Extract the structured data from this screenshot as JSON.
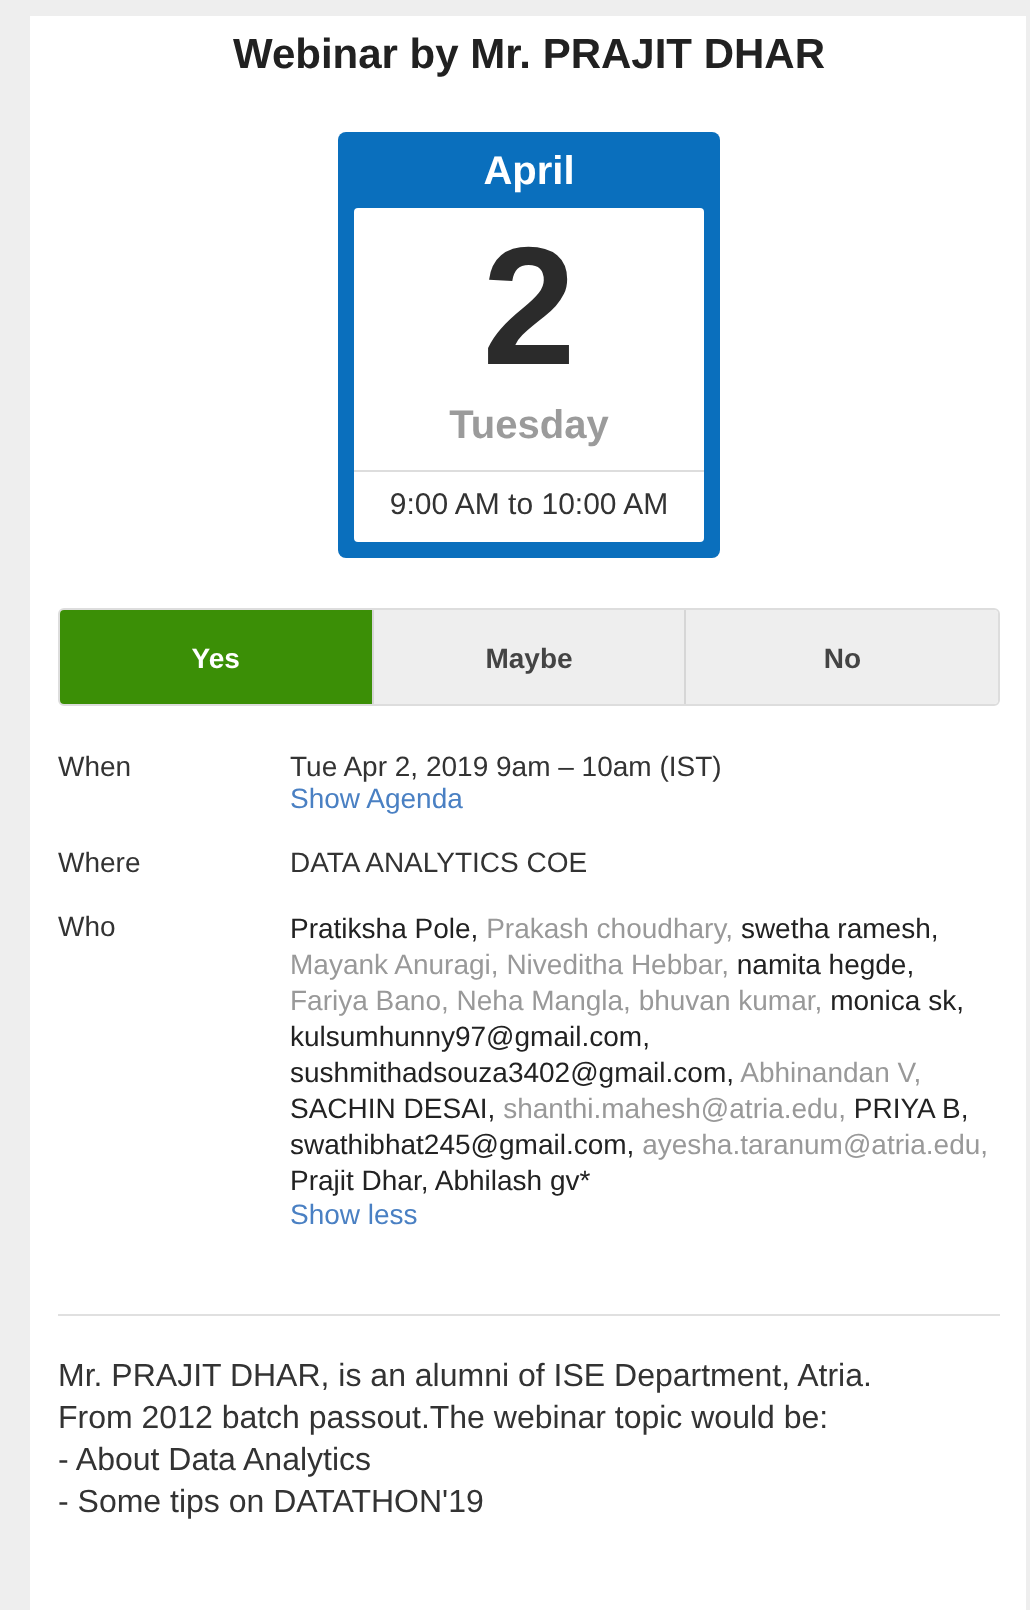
{
  "title": "Webinar by Mr. PRAJIT DHAR",
  "calendar": {
    "month": "April",
    "day": "2",
    "weekday": "Tuesday",
    "time": "9:00 AM to 10:00 AM"
  },
  "rsvp": [
    {
      "label": "Yes",
      "selected": true
    },
    {
      "label": "Maybe",
      "selected": false
    },
    {
      "label": "No",
      "selected": false
    }
  ],
  "details": [
    {
      "label": "When",
      "value": "Tue Apr 2, 2019 9am – 10am (IST)",
      "link": "Show Agenda"
    },
    {
      "label": "Where",
      "value": "DATA ANALYTICS COE"
    }
  ],
  "who": {
    "label": "Who",
    "link": "Show less",
    "guests": [
      {
        "name": "Pratiksha Pole,",
        "greyed": false
      },
      {
        "name": "Prakash choudhary,",
        "greyed": true
      },
      {
        "name": "swetha ramesh,",
        "greyed": false
      },
      {
        "name": "Mayank Anuragi,",
        "greyed": true
      },
      {
        "name": "Niveditha Hebbar,",
        "greyed": true
      },
      {
        "name": "namita hegde,",
        "greyed": false
      },
      {
        "name": "Fariya Bano,",
        "greyed": true
      },
      {
        "name": "Neha Mangla,",
        "greyed": true
      },
      {
        "name": "bhuvan kumar,",
        "greyed": true
      },
      {
        "name": "monica sk,",
        "greyed": false
      },
      {
        "name": "kulsumhunny97@gmail.com,",
        "greyed": false
      },
      {
        "name": "sushmithadsouza3402@gmail.com,",
        "greyed": false
      },
      {
        "name": "Abhinandan V,",
        "greyed": true
      },
      {
        "name": "SACHIN DESAI,",
        "greyed": false
      },
      {
        "name": "shanthi.mahesh@atria.edu,",
        "greyed": true
      },
      {
        "name": "PRIYA B,",
        "greyed": false
      },
      {
        "name": "swathibhat245@gmail.com,",
        "greyed": false
      },
      {
        "name": "ayesha.taranum@atria.edu,",
        "greyed": true
      },
      {
        "name": "Prajit Dhar,",
        "greyed": false
      },
      {
        "name": "Abhilash gv*",
        "greyed": false
      }
    ]
  },
  "description": "Mr. PRAJIT DHAR, is an alumni of ISE Department, Atria.\nFrom 2012 batch passout.The webinar topic would be:\n- About Data Analytics\n- Some tips on DATATHON'19"
}
